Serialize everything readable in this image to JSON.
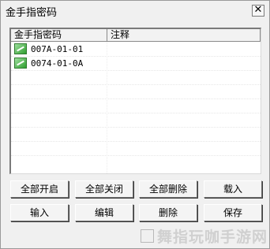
{
  "window": {
    "title": "金手指密码",
    "close_glyph": "✕"
  },
  "list": {
    "columns": [
      "金手指密码",
      "注释"
    ],
    "rows": [
      {
        "code": "007A-01-01",
        "note": "",
        "checked": true
      },
      {
        "code": "0074-01-0A",
        "note": "",
        "checked": true
      }
    ]
  },
  "buttons": {
    "enable_all": "全部开启",
    "disable_all": "全部关闭",
    "delete_all": "全部删除",
    "load": "载入",
    "input": "输入",
    "edit": "编辑",
    "delete": "删除",
    "save": "保存"
  },
  "watermark": {
    "text": "舞指玩咖手游网"
  }
}
